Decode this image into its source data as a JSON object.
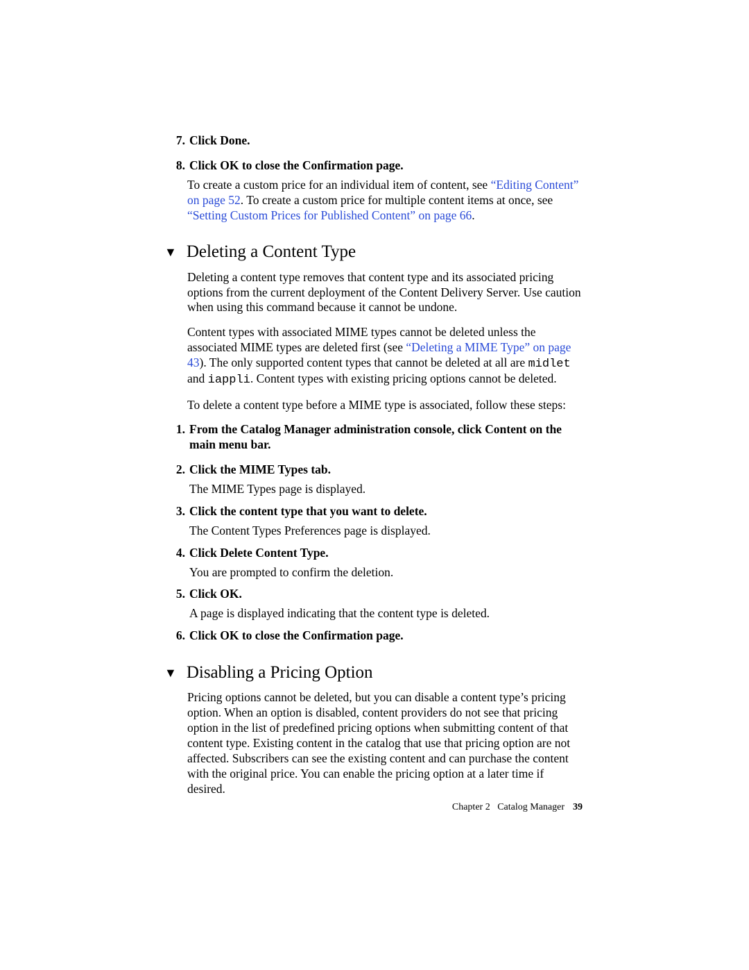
{
  "top_steps": {
    "s7": {
      "num": "7.",
      "text": "Click Done."
    },
    "s8": {
      "num": "8.",
      "text": "Click OK to close the Confirmation page.",
      "para_a": "To create a custom price for an individual item of content, see ",
      "link_a": "“Editing Content” on page 52",
      "para_b": ". To create a custom price for multiple content items at once, see ",
      "link_b": "“Setting Custom Prices for Published Content” on page 66",
      "para_c": "."
    }
  },
  "sec1": {
    "title": "Deleting a Content Type",
    "p1": "Deleting a content type removes that content type and its associated pricing options from the current deployment of the Content Delivery Server. Use caution when using this command because it cannot be undone.",
    "p2a": "Content types with associated MIME types cannot be deleted unless the associated MIME types are deleted first (see ",
    "p2link": "“Deleting a MIME Type” on page 43",
    "p2b": "). The only supported content types that cannot be deleted at all are ",
    "code1": "midlet",
    "p2c": " and ",
    "code2": "iappli",
    "p2d": ". Content types with existing pricing options cannot be deleted.",
    "p3": "To delete a content type before a MIME type is associated, follow these steps:",
    "steps": {
      "s1": {
        "num": "1.",
        "text": "From the Catalog Manager administration console, click Content on the main menu bar."
      },
      "s2": {
        "num": "2.",
        "text": "Click the MIME Types tab.",
        "sub": "The MIME Types page is displayed."
      },
      "s3": {
        "num": "3.",
        "text": "Click the content type that you want to delete.",
        "sub": "The Content Types Preferences page is displayed."
      },
      "s4": {
        "num": "4.",
        "text": "Click Delete Content Type.",
        "sub": "You are prompted to confirm the deletion."
      },
      "s5": {
        "num": "5.",
        "text": "Click OK.",
        "sub": "A page is displayed indicating that the content type is deleted."
      },
      "s6": {
        "num": "6.",
        "text": "Click OK to close the Confirmation page."
      }
    }
  },
  "sec2": {
    "title": "Disabling a Pricing Option",
    "p1": "Pricing options cannot be deleted, but you can disable a content type’s pricing option. When an option is disabled, content providers do not see that pricing option in the list of predefined pricing options when submitting content of that content type. Existing content in the catalog that use that pricing option are not affected. Subscribers can see the existing content and can purchase the content with the original price. You can enable the pricing option at a later time if desired."
  },
  "footer": {
    "chapter": "Chapter 2",
    "title": "Catalog Manager",
    "page": "39"
  }
}
